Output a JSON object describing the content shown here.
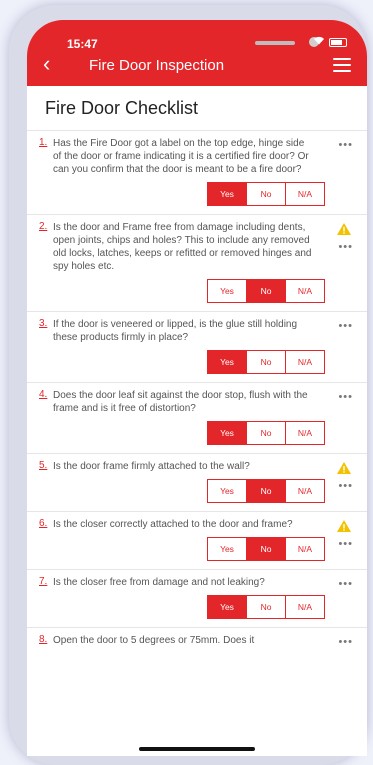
{
  "statusbar": {
    "time": "15:47"
  },
  "header": {
    "back_glyph": "‹",
    "title": "Fire Door Inspection"
  },
  "page": {
    "title": "Fire Door Checklist"
  },
  "button_labels": [
    "Yes",
    "No",
    "N/A"
  ],
  "accent_color": "#e3262a",
  "questions": [
    {
      "number": "1.",
      "text": "Has the Fire Door got a label on the top edge, hinge side of the door or frame indicating it is a certified fire door? Or can you confirm that the door is meant to be a fire door?",
      "selected": "Yes",
      "warning": false
    },
    {
      "number": "2.",
      "text": "Is the door and Frame free from damage including dents, open joints, chips and holes? This to include any removed old locks, latches, keeps or refitted or removed hinges and spy holes etc.",
      "selected": "No",
      "warning": true
    },
    {
      "number": "3.",
      "text": "If the door is veneered or lipped, is the glue still holding these products firmly in place?",
      "selected": "Yes",
      "warning": false
    },
    {
      "number": "4.",
      "text": "Does the door leaf sit against the door stop, flush with the frame and is it free of distortion?",
      "selected": "Yes",
      "warning": false
    },
    {
      "number": "5.",
      "text": "Is the door frame firmly attached to the wall?",
      "selected": "No",
      "warning": true
    },
    {
      "number": "6.",
      "text": "Is the closer correctly attached to the door and frame?",
      "selected": "No",
      "warning": true
    },
    {
      "number": "7.",
      "text": "Is the closer free from damage and not leaking?",
      "selected": "Yes",
      "warning": false
    },
    {
      "number": "8.",
      "text": "Open the door to 5 degrees or 75mm. Does it",
      "selected": null,
      "warning": false
    }
  ]
}
